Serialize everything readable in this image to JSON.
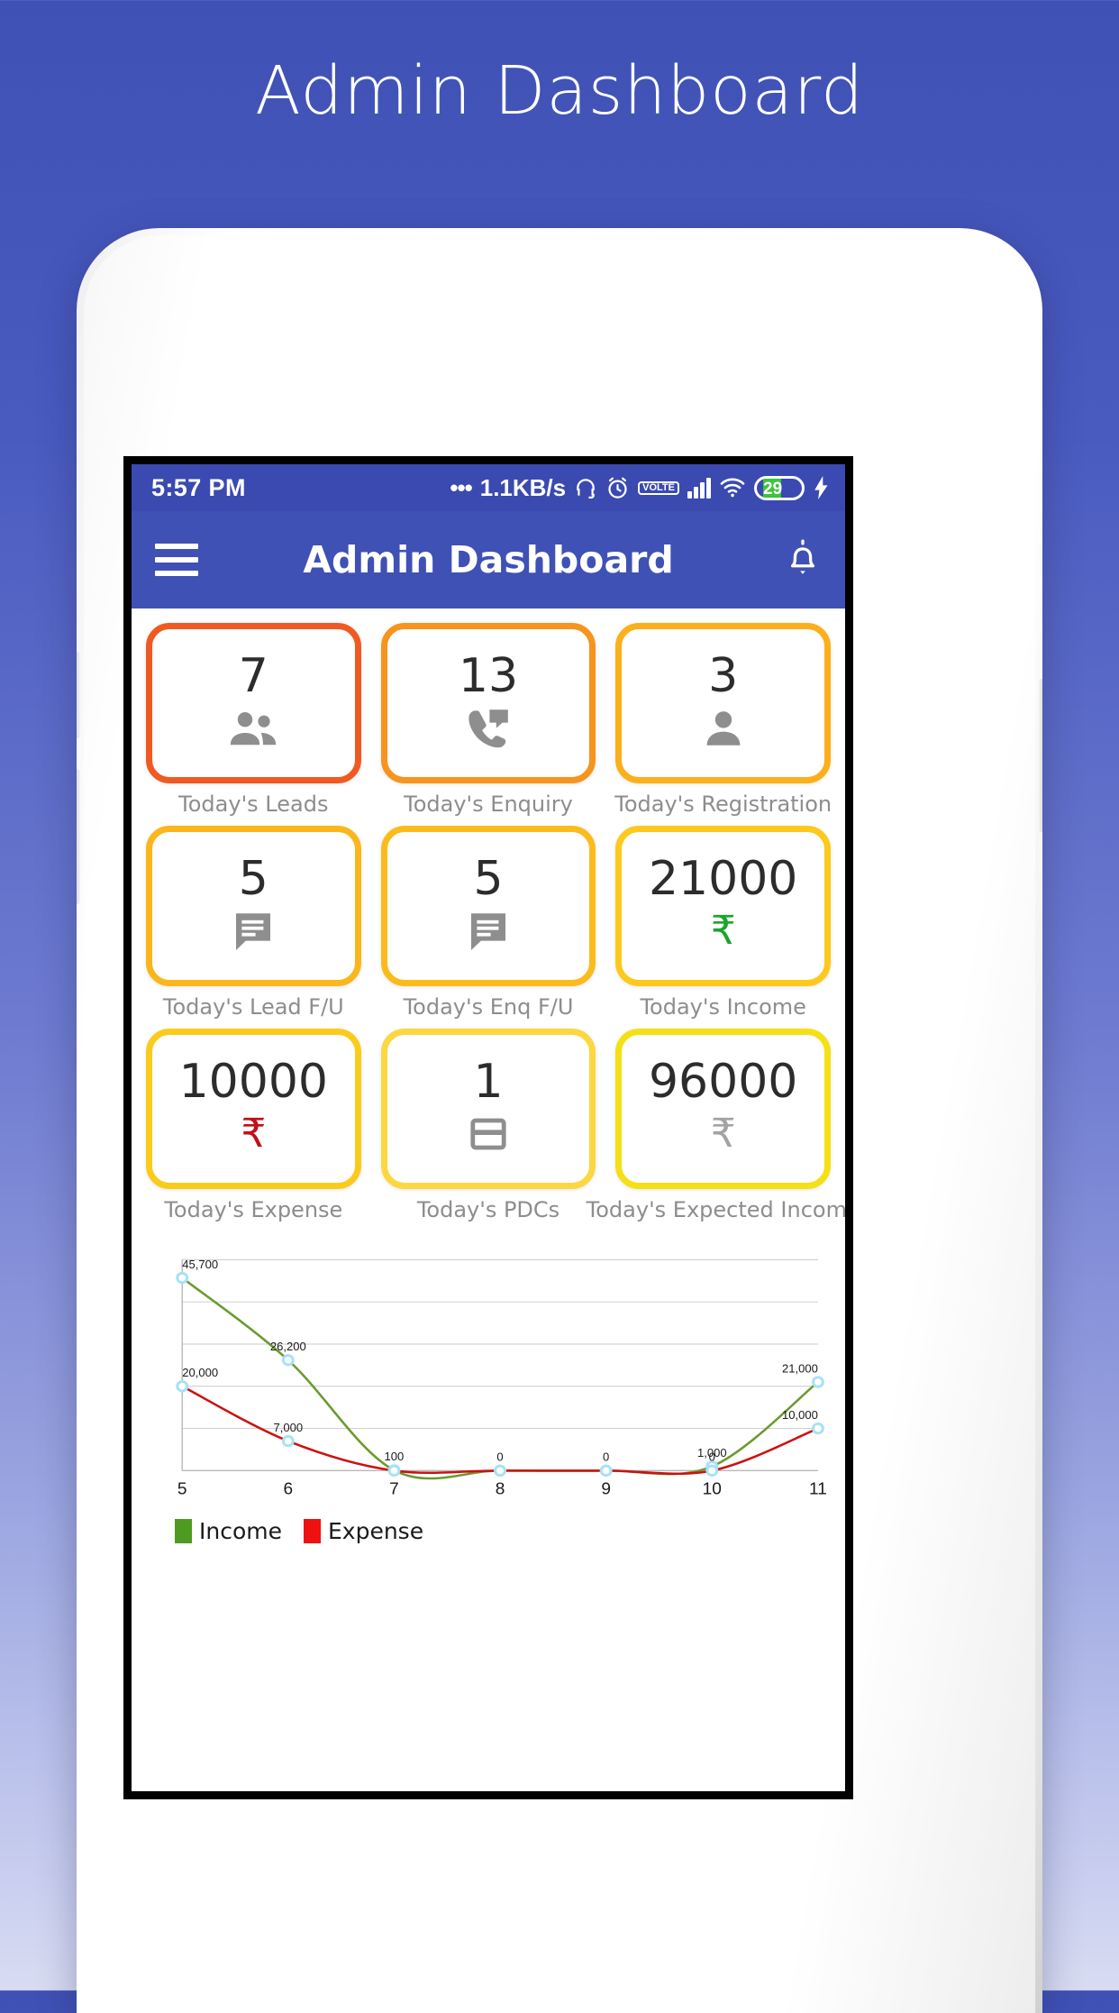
{
  "page": {
    "title": "Admin Dashboard"
  },
  "statusbar": {
    "time": "5:57 PM",
    "dots": "•••",
    "net_speed": "1.1KB/s",
    "icons": [
      "headphone-icon",
      "alarm-icon",
      "volte-icon",
      "signal-icon",
      "wifi-icon",
      "battery-icon",
      "charging-bolt-icon"
    ],
    "volte_top": "VO",
    "volte_bottom": "LTE",
    "battery_percent": "29"
  },
  "appbar": {
    "title": "Admin Dashboard",
    "menu_icon": "hamburger-icon",
    "notification_icon": "bell-icon"
  },
  "cards": [
    {
      "value": "7",
      "label": "Today's Leads",
      "icon": "people-icon",
      "border": "#f05a22",
      "icon_color": "#8e8e8e"
    },
    {
      "value": "13",
      "label": "Today's Enquiry",
      "icon": "phone-in-talk-icon",
      "border": "#f7941e",
      "icon_color": "#8e8e8e"
    },
    {
      "value": "3",
      "label": "Today's Registration",
      "icon": "person-icon",
      "border": "#fbb01b",
      "icon_color": "#8e8e8e"
    },
    {
      "value": "5",
      "label": "Today's Lead F/U",
      "icon": "chat-icon",
      "border": "#fbb61c",
      "icon_color": "#8e8e8e"
    },
    {
      "value": "5",
      "label": "Today's Enq F/U",
      "icon": "chat-icon",
      "border": "#fcbb1d",
      "icon_color": "#8e8e8e"
    },
    {
      "value": "21000",
      "label": "Today's Income",
      "icon": "rupee-icon",
      "border": "#fdc91d",
      "icon_color": "#1aa52b"
    },
    {
      "value": "10000",
      "label": "Today's Expense",
      "icon": "rupee-icon",
      "border": "#fbcb1c",
      "icon_color": "#c0111b"
    },
    {
      "value": "1",
      "label": "Today's PDCs",
      "icon": "credit-card-icon",
      "border": "#fcd741",
      "icon_color": "#8e8e8e"
    },
    {
      "value": "96000",
      "label": "Today's Expected Income",
      "icon": "rupee-icon",
      "border": "#f5e016",
      "icon_color": "#a3a3a3"
    }
  ],
  "chart_data": {
    "type": "line",
    "title": "",
    "xlabel": "",
    "ylabel": "",
    "x": [
      5,
      6,
      7,
      8,
      9,
      10,
      11
    ],
    "xticklabels": [
      "5",
      "6",
      "7",
      "8",
      "9",
      "10",
      "11"
    ],
    "ylim": [
      0,
      50000
    ],
    "grid": true,
    "gridlines": [
      0,
      10000,
      20000,
      30000,
      40000,
      50000
    ],
    "legend_position": "bottom-left",
    "series": [
      {
        "name": "Income",
        "color": "#6b9a2f",
        "values": [
          45700,
          26200,
          100,
          0,
          0,
          1000,
          21000
        ],
        "labels": [
          "45,700",
          "26,200",
          "100",
          "0",
          "0",
          "1,000",
          "21,000"
        ]
      },
      {
        "name": "Expense",
        "color": "#cc1111",
        "values": [
          20000,
          7000,
          0,
          0,
          0,
          0,
          10000
        ],
        "labels": [
          "20,000",
          "7,000",
          "",
          "",
          "",
          "0",
          "10,000"
        ]
      }
    ],
    "marker_color": "#a6e2f5",
    "marker_fill": "#ffffff"
  },
  "legend": [
    {
      "name": "Income",
      "color": "#4f9b22"
    },
    {
      "name": "Expense",
      "color": "#ee1111"
    }
  ]
}
